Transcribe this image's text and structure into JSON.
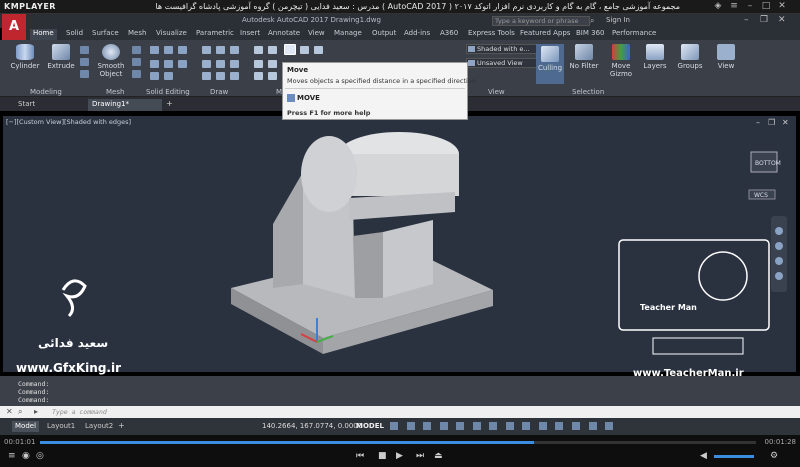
{
  "player": {
    "logo": "KMPLAYER",
    "video_title": "مجموعه آموزشی جامع ، گام به گام و کاربردی نرم افزار  اتوکد ۲۰۱۷ ( AutoCAD 2017 )  مدرس : سعید فدایی ( تیچرمن ) گروه آموزشی پادشاه گرافیست ها",
    "time_current": "00:01:01",
    "time_total": "00:01:28",
    "progress_fraction": 0.69
  },
  "acad": {
    "logo": "A",
    "app_title": "Autodesk AutoCAD 2017    Drawing1.dwg",
    "search_placeholder": "Type a keyword or phrase",
    "sign_in": "Sign In",
    "tabs": [
      "Home",
      "Solid",
      "Surface",
      "Mesh",
      "Visualize",
      "Parametric",
      "Insert",
      "Annotate",
      "View",
      "Manage",
      "Output",
      "Add-ins",
      "A360",
      "Express Tools",
      "Featured Apps",
      "BIM 360",
      "Performance"
    ],
    "active_tab": "Home"
  },
  "ribbon": {
    "tools": {
      "cylinder": "Cylinder",
      "extrude": "Extrude",
      "smooth_object": "Smooth Object",
      "unsaved_view": "Unsaved View",
      "shaded_with_edges": "Shaded with e...",
      "culling": "Culling",
      "no_filter": "No Filter",
      "move_gizmo": "Move Gizmo",
      "layers": "Layers",
      "groups": "Groups",
      "view": "View"
    },
    "panels": {
      "modeling": "Modeling",
      "mesh": "Mesh",
      "solid_editing": "Solid Editing",
      "draw": "Draw",
      "modify": "M",
      "view": "View",
      "selection": "Selection"
    }
  },
  "file_tabs": [
    "Start",
    "Drawing1*"
  ],
  "viewport": {
    "label": "[−][Custom View][Shaded with edges]",
    "viewcube_label": "BOTTOM",
    "wcs": "WCS"
  },
  "tooltip": {
    "title": "Move",
    "description": "Moves objects a specified distance in a specified direction",
    "command": "MOVE",
    "help": "Press F1 for more help"
  },
  "command": {
    "lines": [
      "Command:",
      "Command:",
      "Command:"
    ],
    "input_placeholder": "Type a command"
  },
  "status": {
    "layout_tabs": [
      "Model",
      "Layout1",
      "Layout2"
    ],
    "coords": "140.2664, 167.0774, 0.0000",
    "mode": "MODEL"
  },
  "watermarks": {
    "left_name": "سعید فدائی",
    "left_site": "www.GfxKing.ir",
    "right_site": "www.TeacherMan.ir",
    "right_logo": "Teacher Man"
  },
  "colors": {
    "accent": "#3b8de0",
    "acad_red": "#c0262d",
    "viewport_bg": "#2a3240"
  }
}
